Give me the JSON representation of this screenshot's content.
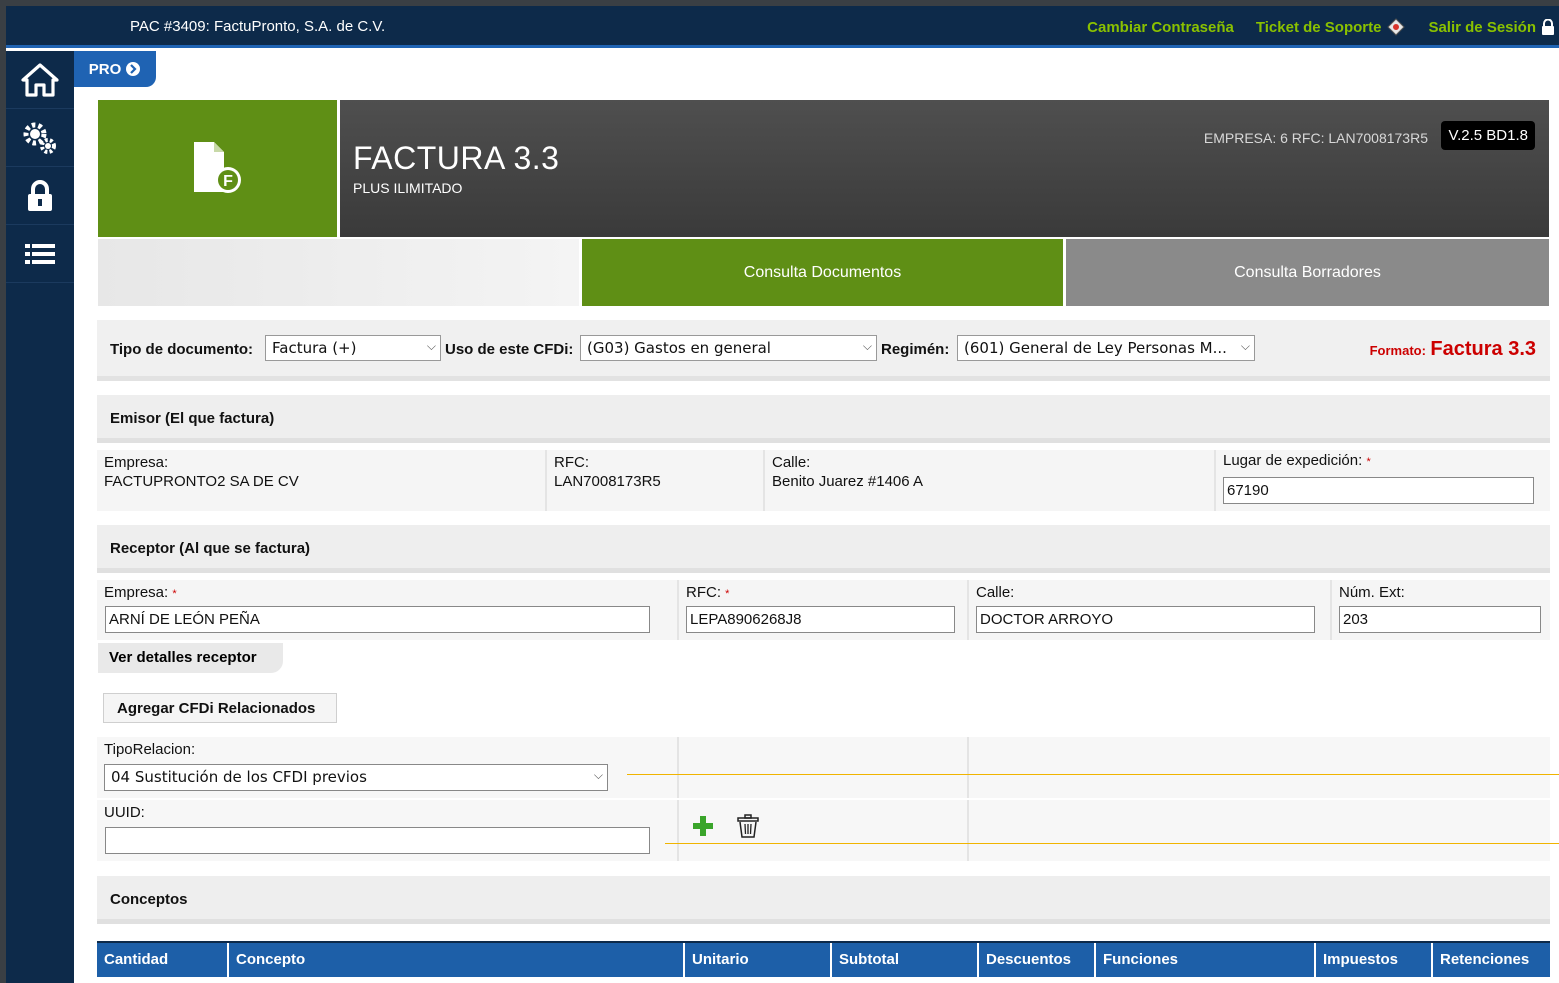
{
  "topbar": {
    "company": "PAC #3409: FactuPronto, S.A. de C.V.",
    "change_password": "Cambiar Contraseña",
    "support_ticket": "Ticket de Soporte",
    "logout": "Salir de Sesión"
  },
  "sidebar": {
    "items": [
      "home-icon",
      "settings-icon",
      "lock-icon",
      "list-icon"
    ]
  },
  "pro_tab": {
    "label": "PRO"
  },
  "header": {
    "title": "FACTURA 3.3",
    "subtitle": "PLUS ILIMITADO",
    "empresa": "EMPRESA: 6 RFC: LAN7008173R5",
    "version": "V.2.5 BD1.8"
  },
  "tabs": {
    "consulta_documentos": "Consulta Documentos",
    "consulta_borradores": "Consulta Borradores"
  },
  "doc_options": {
    "tipo_label": "Tipo de documento:",
    "tipo_value": "Factura (+)",
    "uso_label": "Uso de este CFDi:",
    "uso_value": "(G03) Gastos en general",
    "regimen_label": "Regimén:",
    "regimen_value": "(601) General de Ley Personas M...",
    "formato_label": "Formato:",
    "formato_value": "Factura 3.3"
  },
  "emisor": {
    "title": "Emisor (El que factura)",
    "empresa_label": "Empresa:",
    "empresa_value": "FACTUPRONTO2 SA DE CV",
    "rfc_label": "RFC:",
    "rfc_value": "LAN7008173R5",
    "calle_label": "Calle:",
    "calle_value": "Benito Juarez #1406 A",
    "lugar_label": "Lugar de expedición:",
    "lugar_value": "67190"
  },
  "receptor": {
    "title": "Receptor (Al que se factura)",
    "empresa_label": "Empresa:",
    "empresa_value": "ARNÍ DE LEÓN PEÑA",
    "rfc_label": "RFC:",
    "rfc_value": "LEPA8906268J8",
    "calle_label": "Calle:",
    "calle_value": "DOCTOR ARROYO",
    "num_label": "Núm. Ext:",
    "num_value": "203",
    "details_button": "Ver detalles receptor"
  },
  "relacionados": {
    "button": "Agregar CFDi Relacionados",
    "tipo_label": "TipoRelacion:",
    "tipo_value": "04 Sustitución de los CFDI previos",
    "uuid_label": "UUID:",
    "uuid_value": ""
  },
  "conceptos": {
    "title": "Conceptos",
    "columns": [
      "Cantidad",
      "Concepto",
      "Unitario",
      "Subtotal",
      "Descuentos",
      "Funciones",
      "Impuestos",
      "Retenciones"
    ]
  },
  "colors": {
    "navy": "#0d2a4a",
    "green": "#5f8f15",
    "blue": "#1d5fa8",
    "link_green": "#8ac100",
    "red": "#cc0000"
  },
  "required_mark": "*",
  "caret": "⌵"
}
